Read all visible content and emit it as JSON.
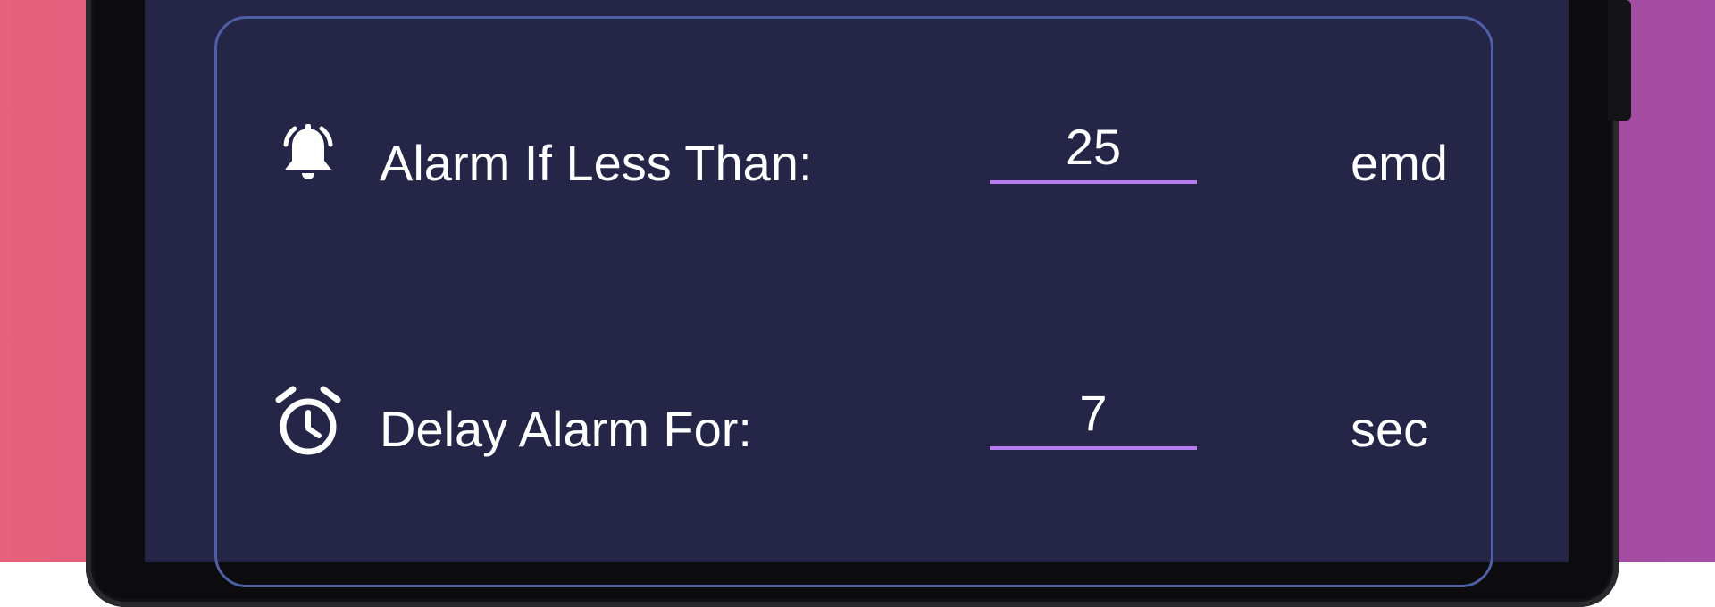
{
  "settings": {
    "alarm_threshold": {
      "label": "Alarm If Less Than:",
      "value": "25",
      "unit": "emd",
      "icon": "bell-ring-icon"
    },
    "alarm_delay": {
      "label": "Delay Alarm For:",
      "value": "7",
      "unit": "sec",
      "icon": "alarm-clock-icon"
    }
  },
  "colors": {
    "screen_background": "#252548",
    "card_border": "#4f5fa5",
    "input_underline": "#b57ef0",
    "text": "#ffffff"
  }
}
